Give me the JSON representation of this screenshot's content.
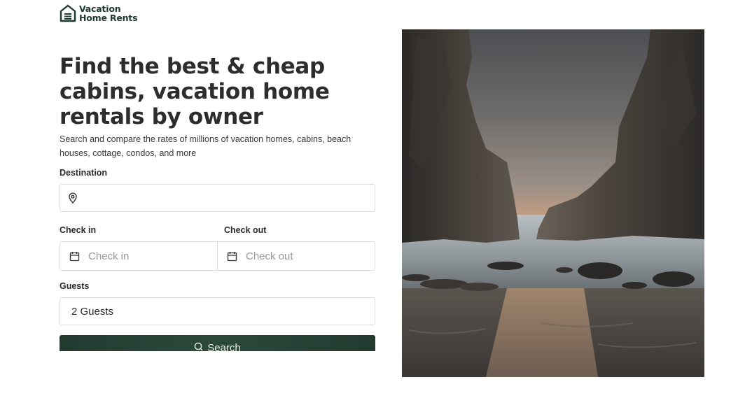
{
  "logo": {
    "line1": "Vacation",
    "line2": "Home Rents",
    "icon": "house-logo-icon",
    "color": "#1f3a2e"
  },
  "hero": {
    "title": "Find the best & cheap cabins, vacation home rentals by owner",
    "subtitle": "Search and compare the rates of millions of vacation homes, cabins, beach houses, cottage, condos, and more"
  },
  "form": {
    "destination": {
      "label": "Destination",
      "value": "",
      "icon": "map-pin-icon"
    },
    "check_in": {
      "label": "Check in",
      "placeholder": "Check in",
      "icon": "calendar-icon"
    },
    "check_out": {
      "label": "Check out",
      "placeholder": "Check out",
      "icon": "calendar-icon"
    },
    "guests": {
      "label": "Guests",
      "value": "2 Guests"
    },
    "search": {
      "label": "Search",
      "icon": "search-icon",
      "color": "#223b30"
    }
  },
  "image": {
    "subject": "sea-cliffs-beach-sunset-photo"
  }
}
